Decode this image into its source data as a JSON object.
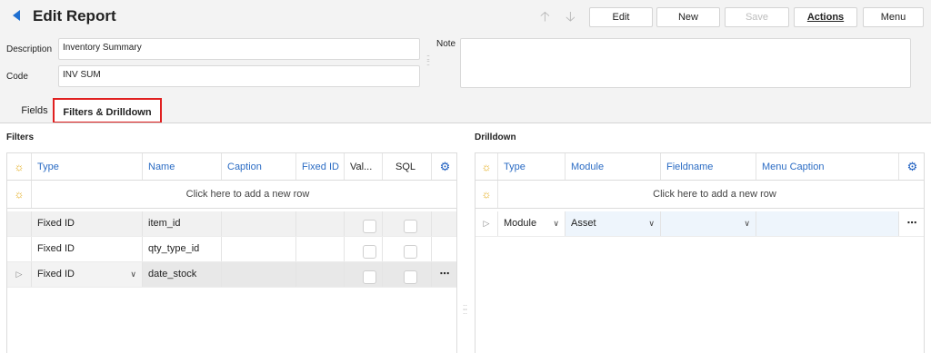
{
  "header": {
    "title": "Edit Report",
    "buttons": {
      "edit": "Edit",
      "new": "New",
      "save": "Save",
      "actions": "Actions",
      "menu": "Menu"
    }
  },
  "form": {
    "description_label": "Description",
    "description_value": "Inventory Summary",
    "code_label": "Code",
    "code_value": "INV SUM",
    "note_label": "Note",
    "note_value": ""
  },
  "tabs": [
    {
      "label": "Fields",
      "active": false
    },
    {
      "label": "Filters & Drilldown",
      "active": true
    }
  ],
  "filters": {
    "section_title": "Filters",
    "columns": [
      "Type",
      "Name",
      "Caption",
      "Fixed ID",
      "Val...",
      "SQL"
    ],
    "add_row_text": "Click here to add a new row",
    "rows": [
      {
        "type": "Fixed ID",
        "name": "item_id",
        "caption": "",
        "fixed_id": "",
        "val": false,
        "sql": false
      },
      {
        "type": "Fixed ID",
        "name": "qty_type_id",
        "caption": "",
        "fixed_id": "",
        "val": false,
        "sql": false
      },
      {
        "type": "Fixed ID",
        "name": "date_stock",
        "caption": "",
        "fixed_id": "",
        "val": false,
        "sql": false
      }
    ]
  },
  "drilldown": {
    "section_title": "Drilldown",
    "columns": [
      "Type",
      "Module",
      "Fieldname",
      "Menu Caption"
    ],
    "add_row_text": "Click here to add a new row",
    "rows": [
      {
        "type": "Module",
        "module": "Asset",
        "fieldname": "",
        "menu_caption": ""
      }
    ]
  },
  "icons": {
    "back": "back-arrow-icon",
    "up": "arrow-up-icon",
    "down": "arrow-down-icon",
    "column_chooser": "gear-icon",
    "new_row": "sun-icon",
    "row_menu": "ellipsis-icon",
    "dropdown": "chevron-down-icon",
    "row_indicator": "triangle-right-icon"
  },
  "colors": {
    "accent": "#1e6fd0",
    "header_text": "#2b6cc4",
    "highlight_border": "#e02020",
    "new_row_icon": "#e0a200"
  }
}
